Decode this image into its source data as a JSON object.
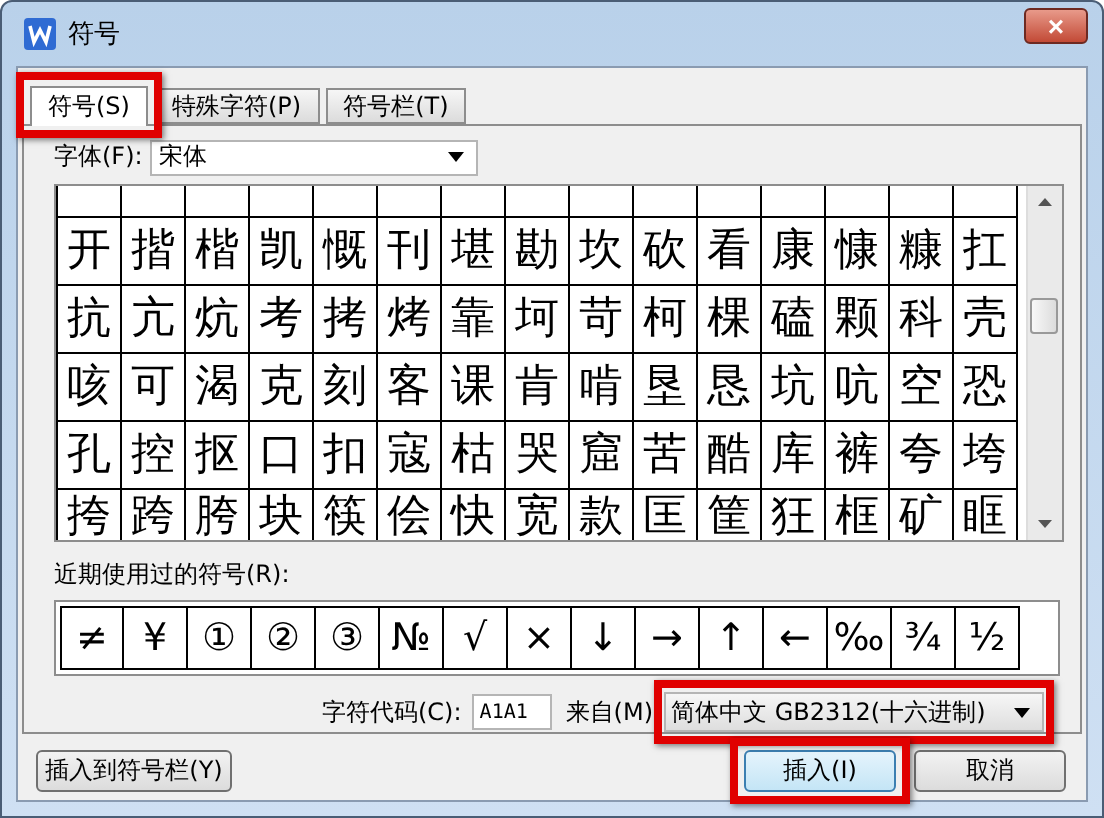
{
  "window": {
    "title": "符号",
    "close": "×"
  },
  "tabs": [
    {
      "label": "符号(S)",
      "selected": true,
      "highlighted": true
    },
    {
      "label": "特殊字符(P)",
      "selected": false,
      "highlighted": false
    },
    {
      "label": "符号栏(T)",
      "selected": false,
      "highlighted": false
    }
  ],
  "font": {
    "label": "字体(F):",
    "value": "宋体"
  },
  "symbols": [
    [
      "开",
      "揩",
      "楷",
      "凯",
      "慨",
      "刊",
      "堪",
      "勘",
      "坎",
      "砍",
      "看",
      "康",
      "慷",
      "糠",
      "扛"
    ],
    [
      "抗",
      "亢",
      "炕",
      "考",
      "拷",
      "烤",
      "靠",
      "坷",
      "苛",
      "柯",
      "棵",
      "磕",
      "颗",
      "科",
      "壳"
    ],
    [
      "咳",
      "可",
      "渴",
      "克",
      "刻",
      "客",
      "课",
      "肯",
      "啃",
      "垦",
      "恳",
      "坑",
      "吭",
      "空",
      "恐"
    ],
    [
      "孔",
      "控",
      "抠",
      "口",
      "扣",
      "寇",
      "枯",
      "哭",
      "窟",
      "苦",
      "酷",
      "库",
      "裤",
      "夸",
      "垮"
    ],
    [
      "挎",
      "跨",
      "胯",
      "块",
      "筷",
      "侩",
      "快",
      "宽",
      "款",
      "匡",
      "筐",
      "狂",
      "框",
      "矿",
      "眶"
    ]
  ],
  "recent": {
    "label": "近期使用过的符号(R):",
    "symbols": [
      "≠",
      "¥",
      "①",
      "②",
      "③",
      "№",
      "√",
      "×",
      "↓",
      "→",
      "↑",
      "←",
      "‰",
      "¾",
      "½"
    ]
  },
  "code": {
    "label": "字符代码(C):",
    "value": "A1A1"
  },
  "source": {
    "label": "来自(M)",
    "value": "简体中文 GB2312(十六进制)",
    "highlighted": true
  },
  "buttons": [
    {
      "label": "插入到符号栏(Y)",
      "highlighted": false
    },
    {
      "label": "插入(I)",
      "highlighted": true,
      "default": true
    },
    {
      "label": "取消",
      "highlighted": false,
      "default": false
    }
  ]
}
